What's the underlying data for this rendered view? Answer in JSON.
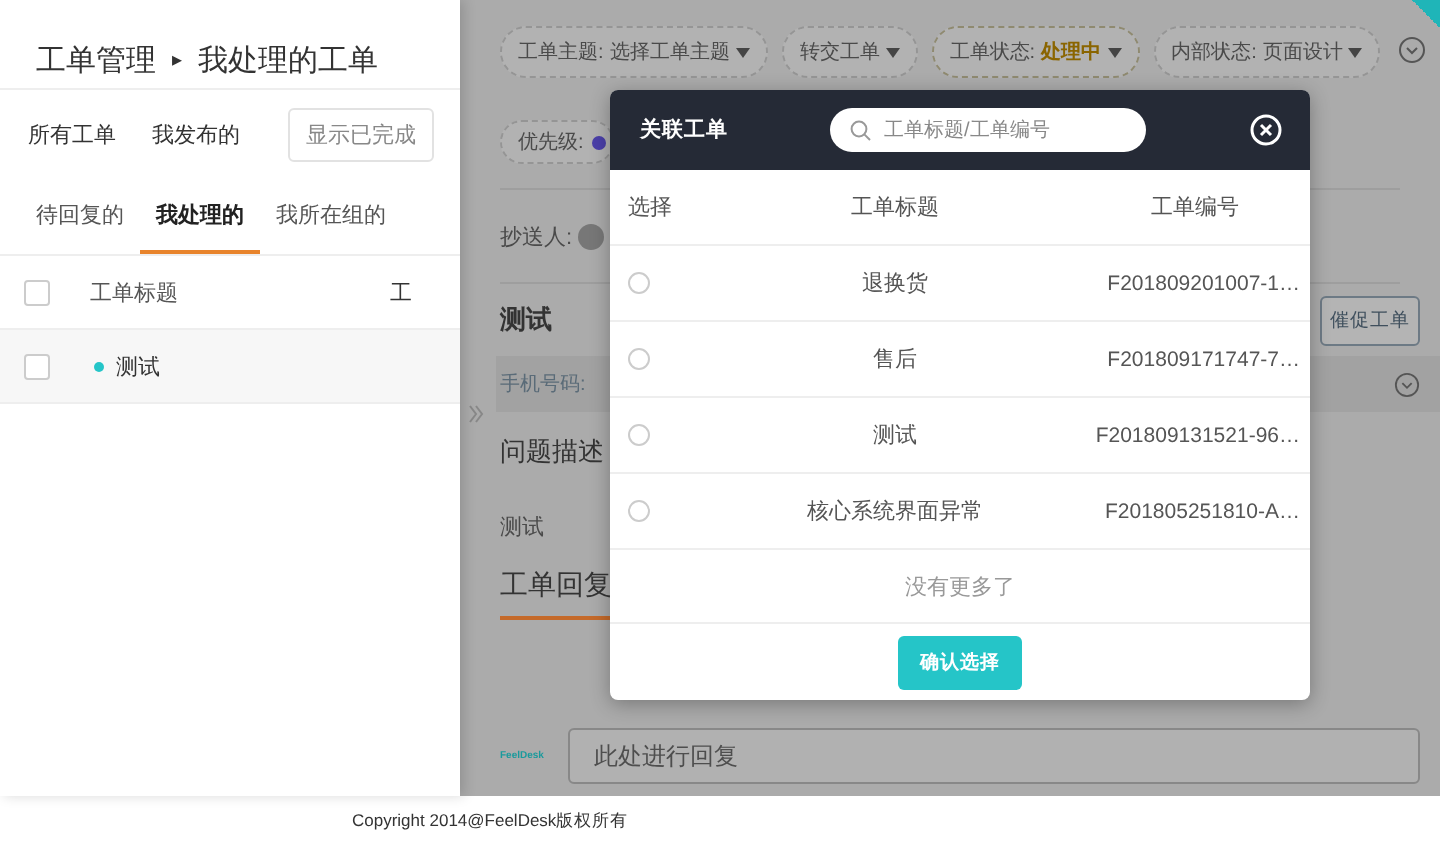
{
  "left_panel": {
    "breadcrumb": {
      "parent": "工单管理",
      "separator": "▸",
      "current": "我处理的工单"
    },
    "filters": [
      "所有工单",
      "我发布的"
    ],
    "show_completed_button": "显示已完成",
    "tabs": [
      {
        "label": "待回复的",
        "selected": false
      },
      {
        "label": "我处理的",
        "selected": true
      },
      {
        "label": "我所在组的",
        "selected": false
      }
    ],
    "table": {
      "select_all_checked": false,
      "columns": [
        "工单标题",
        "工"
      ],
      "rows": [
        {
          "title": "测试",
          "checked": false
        }
      ]
    }
  },
  "detail_panel": {
    "pills": [
      {
        "label": "工单主题:",
        "value": "选择工单主题",
        "highlighted": false
      },
      {
        "label": "转交工单",
        "highlighted": false
      },
      {
        "label": "工单状态:",
        "value": "处理中",
        "highlighted": true
      },
      {
        "label": "内部状态:",
        "value": "页面设计",
        "highlighted": false
      }
    ],
    "priority_label": "优先级:",
    "cc_label": "抄送人:",
    "ticket_title": "测试",
    "urge_button": "催促工单",
    "phone_label": "手机号码:",
    "description_heading": "问题描述",
    "description": "测试",
    "reply_tab": "工单回复",
    "reply_logo": "FeelDesk",
    "reply_placeholder": "此处进行回复"
  },
  "modal": {
    "title": "关联工单",
    "search_placeholder": "工单标题/工单编号",
    "columns": [
      "选择",
      "工单标题",
      "工单编号"
    ],
    "rows": [
      {
        "title": "退换货",
        "id": "F201809201007-1…",
        "selected": false
      },
      {
        "title": "售后",
        "id": "F201809171747-7…",
        "selected": false
      },
      {
        "title": "测试",
        "id": "F201809131521-96…",
        "selected": false
      },
      {
        "title": "核心系统界面异常",
        "id": "F201805251810-A…",
        "selected": false
      }
    ],
    "end_text": "没有更多了",
    "confirm_button": "确认选择"
  },
  "footer": "Copyright 2014@FeelDesk版权所有"
}
